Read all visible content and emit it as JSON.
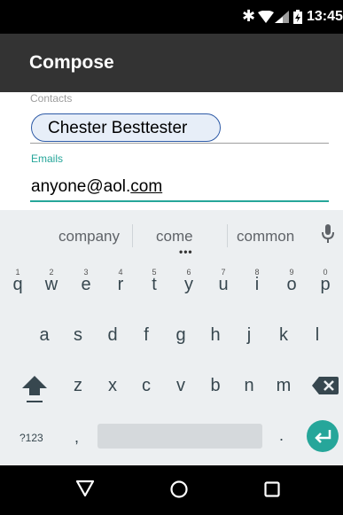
{
  "status_bar": {
    "time": "13:45",
    "icons": [
      "bluetooth-icon",
      "wifi-icon",
      "signal-icon",
      "battery-charging-icon"
    ]
  },
  "app_bar": {
    "title": "Compose"
  },
  "form": {
    "contacts_label": "Contacts",
    "contact_chip": "Chester Besttester",
    "emails_label": "Emails",
    "email_value_prefix": "anyone@aol.",
    "email_value_suffix": "com"
  },
  "keyboard": {
    "suggestions": [
      "company",
      "come",
      "common"
    ],
    "row1": [
      {
        "key": "q",
        "hint": "1"
      },
      {
        "key": "w",
        "hint": "2"
      },
      {
        "key": "e",
        "hint": "3"
      },
      {
        "key": "r",
        "hint": "4"
      },
      {
        "key": "t",
        "hint": "5"
      },
      {
        "key": "y",
        "hint": "6"
      },
      {
        "key": "u",
        "hint": "7"
      },
      {
        "key": "i",
        "hint": "8"
      },
      {
        "key": "o",
        "hint": "9"
      },
      {
        "key": "p",
        "hint": "0"
      }
    ],
    "row2": [
      "a",
      "s",
      "d",
      "f",
      "g",
      "h",
      "j",
      "k",
      "l"
    ],
    "row3": [
      "z",
      "x",
      "c",
      "v",
      "b",
      "n",
      "m"
    ],
    "symbols_key": "?123",
    "comma": ",",
    "period": ".",
    "accent_color": "#26a69a"
  },
  "nav_bar": {
    "icons": [
      "back-icon",
      "home-icon",
      "recents-icon"
    ]
  }
}
